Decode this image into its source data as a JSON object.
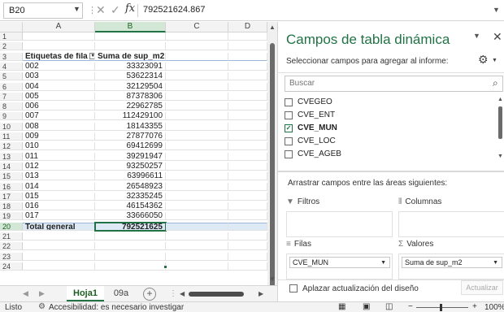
{
  "formula_bar": {
    "name_box": "B20",
    "fx_label": "fx",
    "value": "792521624.867"
  },
  "grid": {
    "columns": [
      "A",
      "B",
      "C",
      "D"
    ],
    "active_column": "B",
    "rows": [
      {
        "num": "1",
        "a": "",
        "b": "",
        "kind": "empty"
      },
      {
        "num": "2",
        "a": "",
        "b": "",
        "kind": "empty"
      },
      {
        "num": "3",
        "a": "Etiquetas de fila",
        "b": "Suma de sup_m2",
        "kind": "header"
      },
      {
        "num": "4",
        "a": "002",
        "b": "33323091",
        "kind": "data"
      },
      {
        "num": "5",
        "a": "003",
        "b": "53622314",
        "kind": "data"
      },
      {
        "num": "6",
        "a": "004",
        "b": "32129504",
        "kind": "data"
      },
      {
        "num": "7",
        "a": "005",
        "b": "87378306",
        "kind": "data"
      },
      {
        "num": "8",
        "a": "006",
        "b": "22962785",
        "kind": "data"
      },
      {
        "num": "9",
        "a": "007",
        "b": "112429100",
        "kind": "data"
      },
      {
        "num": "10",
        "a": "008",
        "b": "18143355",
        "kind": "data"
      },
      {
        "num": "11",
        "a": "009",
        "b": "27877076",
        "kind": "data"
      },
      {
        "num": "12",
        "a": "010",
        "b": "69412699",
        "kind": "data"
      },
      {
        "num": "13",
        "a": "011",
        "b": "39291947",
        "kind": "data"
      },
      {
        "num": "14",
        "a": "012",
        "b": "93250257",
        "kind": "data"
      },
      {
        "num": "15",
        "a": "013",
        "b": "63996611",
        "kind": "data"
      },
      {
        "num": "16",
        "a": "014",
        "b": "26548923",
        "kind": "data"
      },
      {
        "num": "17",
        "a": "015",
        "b": "32335245",
        "kind": "data"
      },
      {
        "num": "18",
        "a": "016",
        "b": "46154362",
        "kind": "data"
      },
      {
        "num": "19",
        "a": "017",
        "b": "33666050",
        "kind": "data"
      },
      {
        "num": "20",
        "a": "Total general",
        "b": "792521625",
        "kind": "total"
      },
      {
        "num": "21",
        "a": "",
        "b": "",
        "kind": "empty"
      },
      {
        "num": "22",
        "a": "",
        "b": "",
        "kind": "empty"
      },
      {
        "num": "23",
        "a": "",
        "b": "",
        "kind": "empty"
      },
      {
        "num": "24",
        "a": "",
        "b": "",
        "kind": "empty"
      }
    ]
  },
  "sheet_tabs": {
    "tabs": [
      "Hoja1",
      "09a"
    ],
    "active": "Hoja1",
    "add_label": "+"
  },
  "status_bar": {
    "ready": "Listo",
    "accessibility": "Accesibilidad: es necesario investigar",
    "zoom": "100%"
  },
  "pivot_pane": {
    "title": "Campos de tabla dinámica",
    "subtitle": "Seleccionar campos para agregar al informe:",
    "search_placeholder": "Buscar",
    "fields": [
      {
        "name": "CVEGEO",
        "checked": false
      },
      {
        "name": "CVE_ENT",
        "checked": false
      },
      {
        "name": "CVE_MUN",
        "checked": true
      },
      {
        "name": "CVE_LOC",
        "checked": false
      },
      {
        "name": "CVE_AGEB",
        "checked": false
      }
    ],
    "areas_title": "Arrastrar campos entre las áreas siguientes:",
    "area_filters": "Filtros",
    "area_columns": "Columnas",
    "area_rows": "Filas",
    "area_values": "Valores",
    "rows_chip": "CVE_MUN",
    "values_chip": "Suma de sup_m2",
    "defer_label": "Aplazar actualización del diseño",
    "update_label": "Actualizar"
  },
  "colors": {
    "accent": "#217346",
    "selection_header": "#d3e7d6",
    "total_row": "#dde9f5"
  },
  "icons": {
    "fx": "function-icon",
    "search": "search-icon",
    "gear": "gear-icon",
    "close": "close-icon",
    "accessibility": "accessibility-icon"
  }
}
